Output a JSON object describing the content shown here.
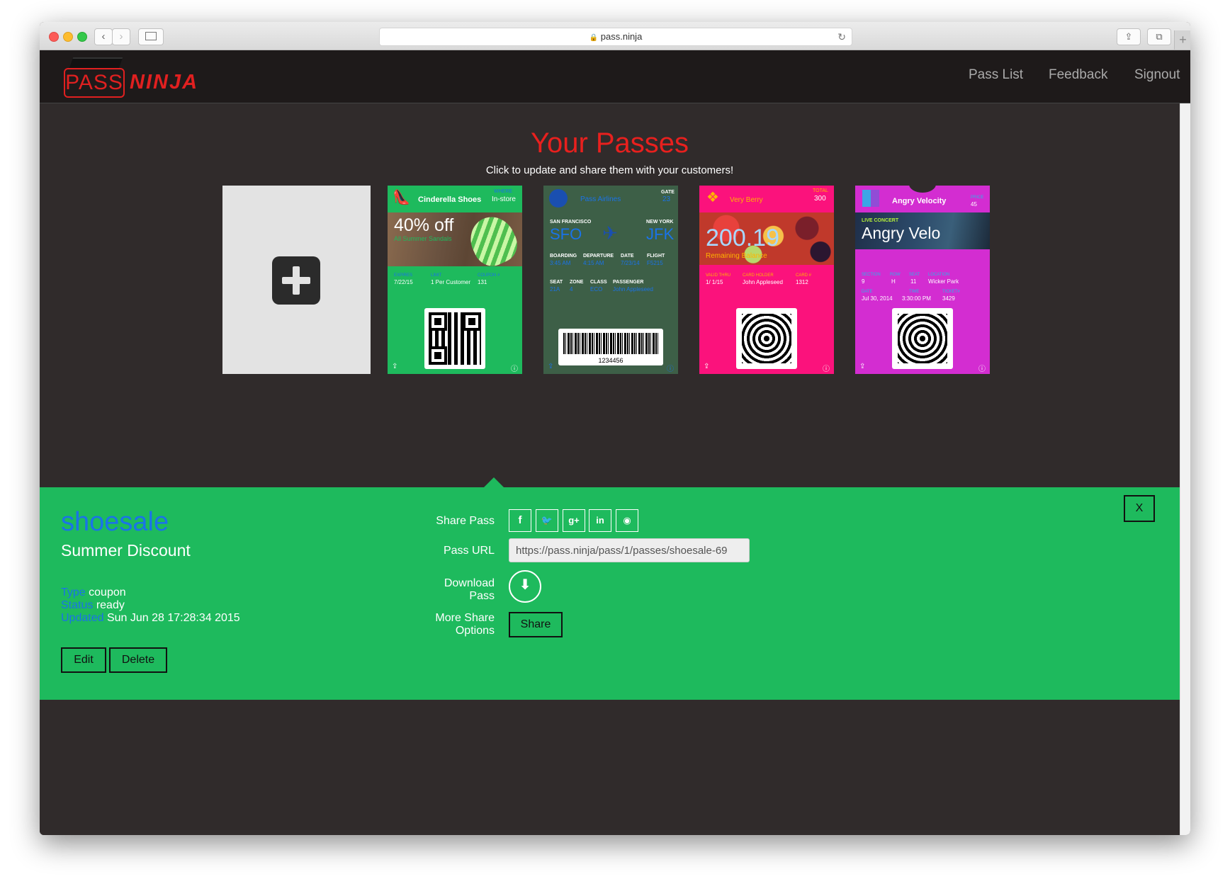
{
  "browser": {
    "url": "pass.ninja"
  },
  "brand": {
    "logo_left": "PASS",
    "logo_right": "NINJA"
  },
  "nav": {
    "items": [
      "Pass List",
      "Feedback",
      "Signout"
    ]
  },
  "page": {
    "title": "Your Passes",
    "subtitle": "Click to update and share them with your customers!"
  },
  "passes": {
    "cinderella": {
      "header": "Cinderella Shoes",
      "header_small_label": "WHERE",
      "header_value": "In-store",
      "headline": "40% off",
      "subline": "All Summer Sandals",
      "fields": [
        {
          "label": "EXPIRES",
          "value": "7/22/15"
        },
        {
          "label": "LIMIT",
          "value": "1 Per Customer"
        },
        {
          "label": "COUPON #",
          "value": "131"
        }
      ]
    },
    "airline": {
      "header": "Pass Airlines",
      "gate_label": "GATE",
      "gate_value": "23",
      "from_label": "SAN FRANCISCO",
      "from_code": "SFO",
      "to_label": "NEW YORK",
      "to_code": "JFK",
      "row1": [
        {
          "label": "BOARDING",
          "value": "3:45 AM"
        },
        {
          "label": "DEPARTURE",
          "value": "4:15 AM"
        },
        {
          "label": "DATE",
          "value": "7/23/14"
        },
        {
          "label": "FLIGHT",
          "value": "F5215"
        }
      ],
      "row2": [
        {
          "label": "SEAT",
          "value": "21A"
        },
        {
          "label": "ZONE",
          "value": "4"
        },
        {
          "label": "CLASS",
          "value": "ECO"
        },
        {
          "label": "PASSENGER",
          "value": "John Appleseed"
        }
      ],
      "barcode_text": "1234456"
    },
    "berry": {
      "header": "Very Berry",
      "total_label": "TOTAL",
      "total_value": "300",
      "balance": "200.19",
      "balance_label": "Remaining Balance",
      "fields": [
        {
          "label": "VALID THRU",
          "value": "1/ 1/15"
        },
        {
          "label": "CARD HOLDER",
          "value": "John Appleseed"
        },
        {
          "label": "CARD #",
          "value": "1312"
        }
      ]
    },
    "velo": {
      "header": "Angry Velocity",
      "price_label": "PRICE",
      "price_value": "45",
      "event_label": "LIVE CONCERT",
      "event_name": "Angry Velo",
      "row1": [
        {
          "label": "SECTION",
          "value": "9"
        },
        {
          "label": "ROW",
          "value": "H"
        },
        {
          "label": "SEAT",
          "value": "11"
        },
        {
          "label": "LOCATION",
          "value": "Wicker Park"
        }
      ],
      "row2": [
        {
          "label": "DATE",
          "value": "Jul 30, 2014"
        },
        {
          "label": "TIME",
          "value": "3:30:00 PM"
        },
        {
          "label": "TICKET#",
          "value": "3429"
        }
      ]
    }
  },
  "detail": {
    "id": "shoesale",
    "name": "Summer Discount",
    "type_label": "Type",
    "type_value": "coupon",
    "status_label": "Status",
    "status_value": "ready",
    "updated_label": "Updated",
    "updated_value": "Sun Jun 28 17:28:34 2015",
    "edit_label": "Edit",
    "delete_label": "Delete",
    "close_label": "X",
    "share_pass_label": "Share Pass",
    "pass_url_label": "Pass URL",
    "pass_url_value": "https://pass.ninja/pass/1/passes/shoesale-69",
    "download_label_1": "Download",
    "download_label_2": "Pass",
    "more_label_1": "More Share",
    "more_label_2": "Options",
    "share_button": "Share",
    "share_icons": [
      "facebook-icon",
      "twitter-icon",
      "google-plus-icon",
      "linkedin-icon",
      "reddit-icon"
    ]
  }
}
